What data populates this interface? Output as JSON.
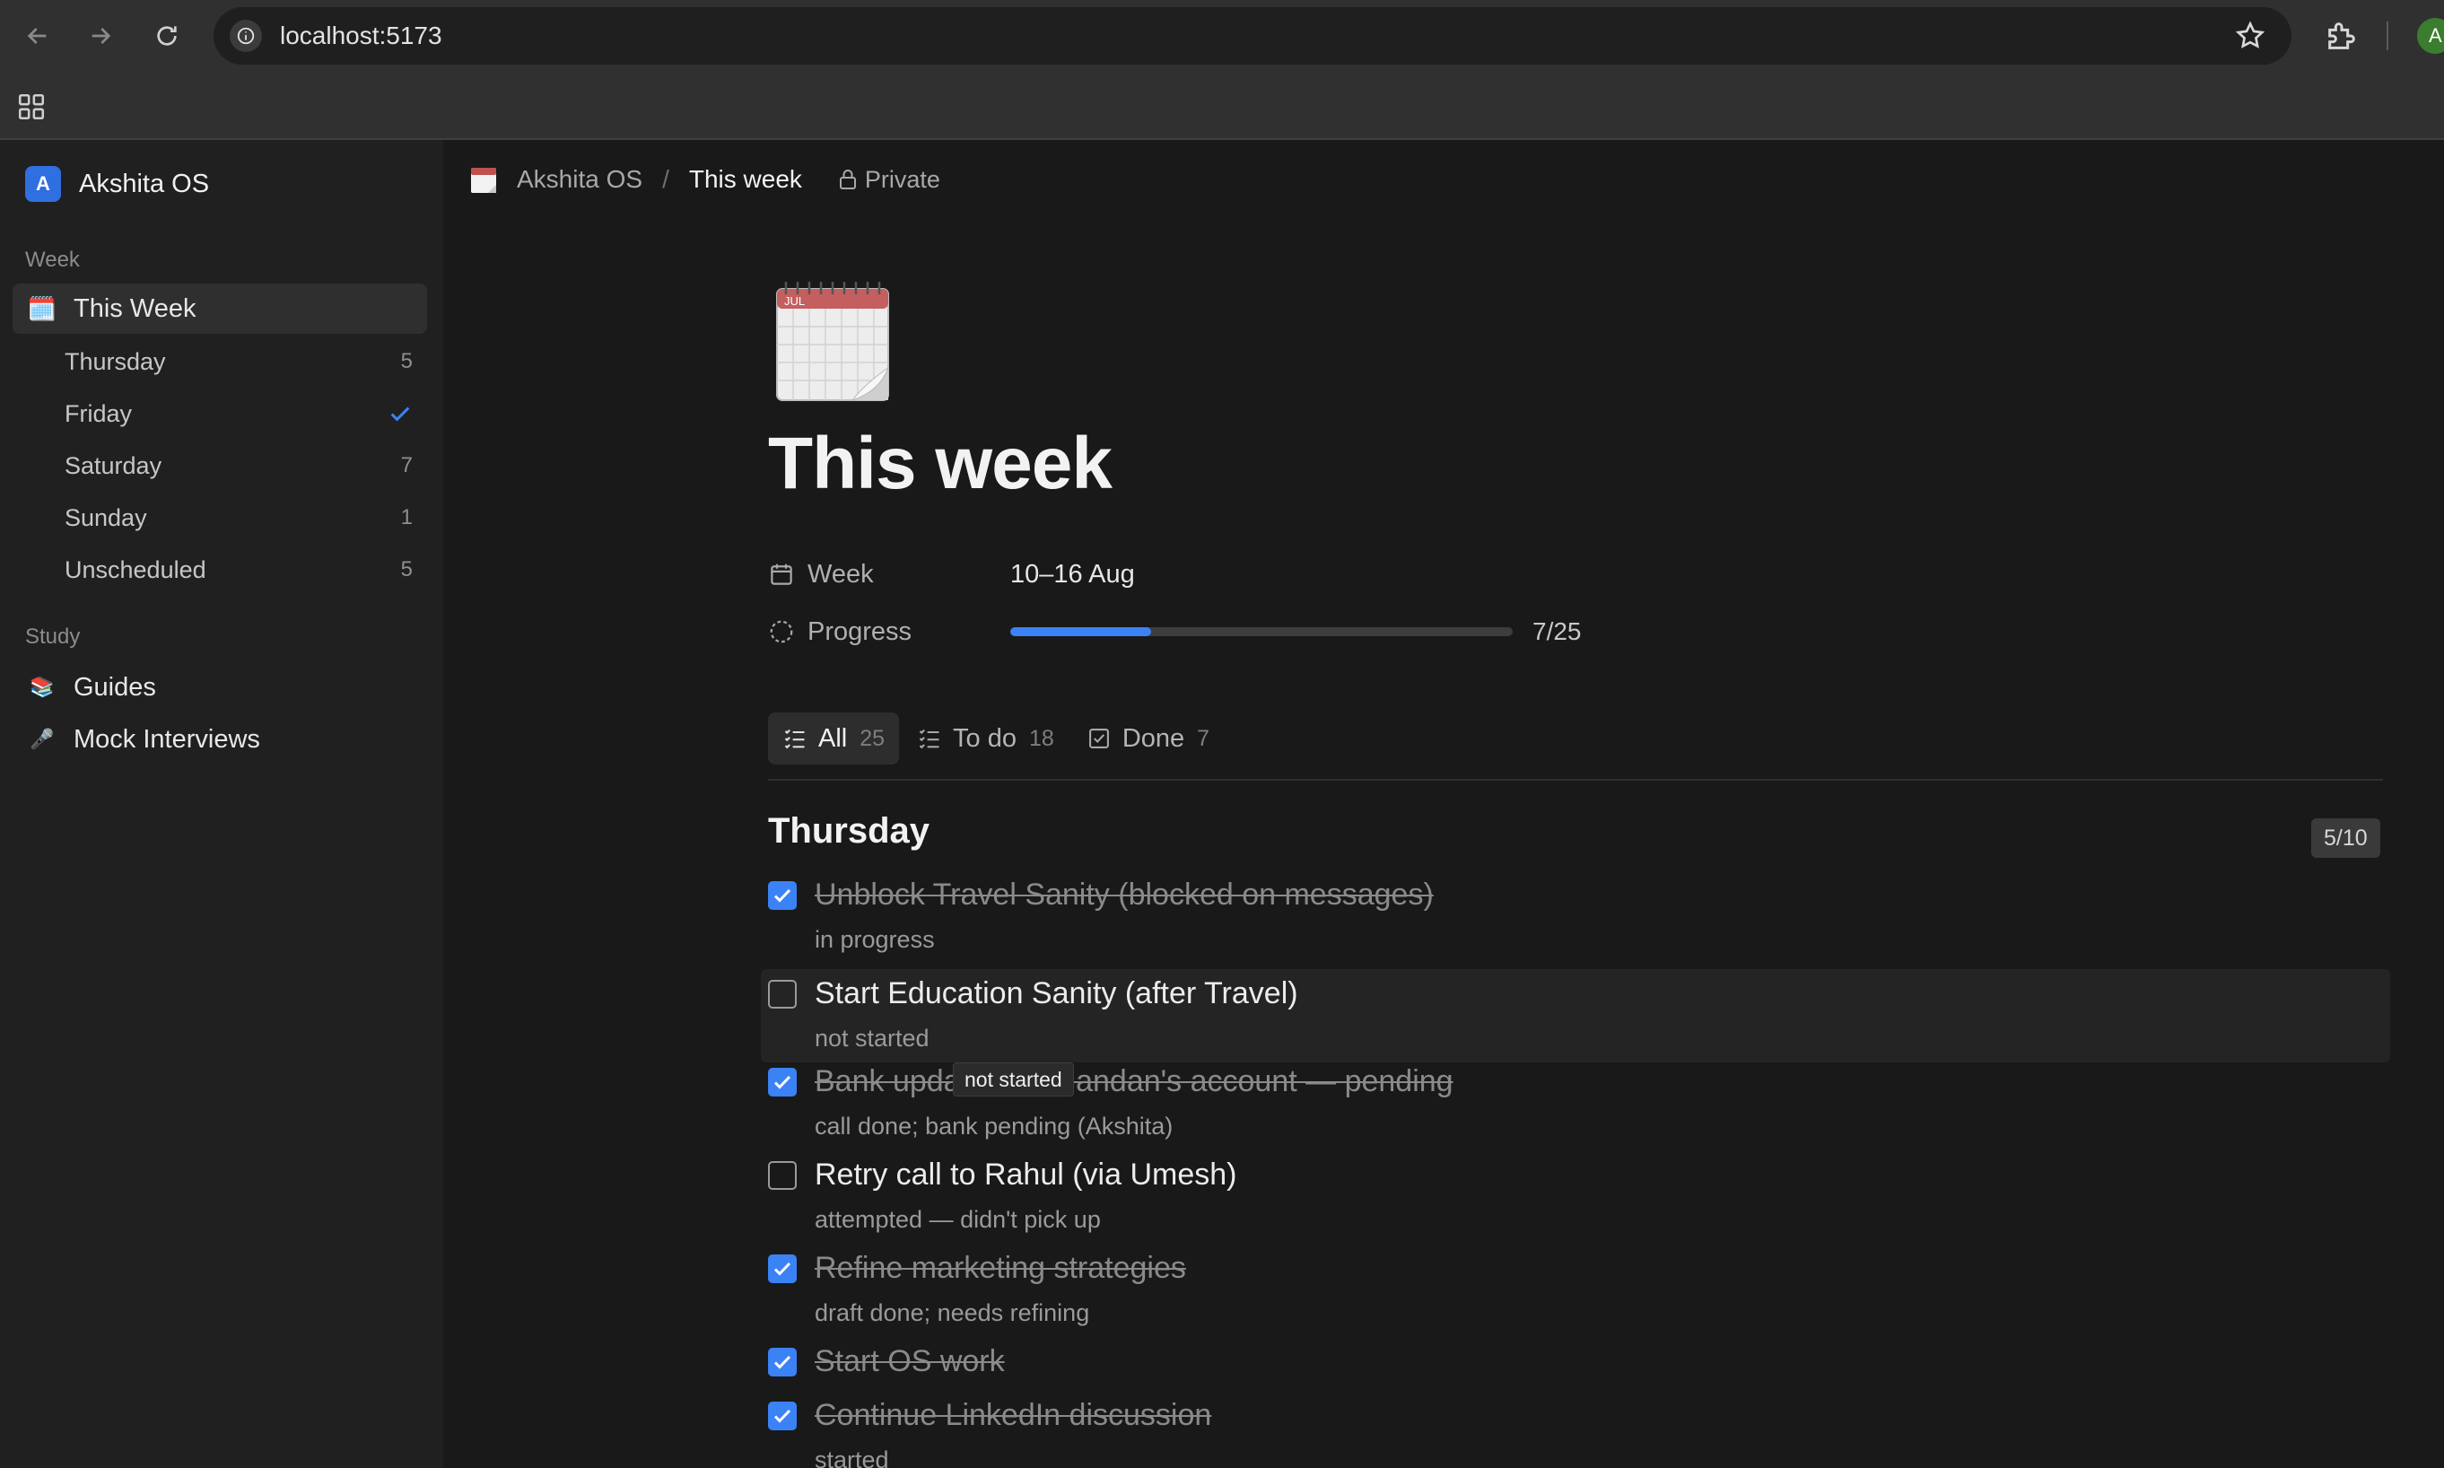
{
  "browser": {
    "url": "localhost:5173",
    "profile_initial": "A"
  },
  "sidebar": {
    "workspace_initial": "A",
    "workspace_name": "Akshita OS",
    "sections": {
      "week": "Week",
      "study": "Study"
    },
    "this_week": {
      "emoji": "🗓️",
      "label": "This Week"
    },
    "days": [
      {
        "label": "Thursday",
        "count": "5"
      },
      {
        "label": "Friday",
        "count": "",
        "status": "done"
      },
      {
        "label": "Saturday",
        "count": "7"
      },
      {
        "label": "Sunday",
        "count": "1"
      },
      {
        "label": "Unscheduled",
        "count": "5"
      }
    ],
    "study_items": [
      {
        "emoji": "📚",
        "label": "Guides"
      },
      {
        "emoji": "🎤",
        "label": "Mock Interviews"
      }
    ]
  },
  "breadcrumb": {
    "workspace": "Akshita OS",
    "separator": "/",
    "page": "This week",
    "visibility": "Private"
  },
  "page": {
    "title": "This week",
    "properties": {
      "week_label": "Week",
      "week_value": "10–16 Aug",
      "progress_label": "Progress",
      "progress_text": "7/25",
      "progress_fraction": 0.28
    },
    "tabs": [
      {
        "label": "All",
        "count": "25"
      },
      {
        "label": "To do",
        "count": "18"
      },
      {
        "label": "Done",
        "count": "7"
      }
    ],
    "group": {
      "title": "Thursday",
      "badge": "5/10",
      "tasks": [
        {
          "title": "Unblock Travel Sanity (blocked on messages)",
          "note": "in progress",
          "done": true
        },
        {
          "title": "Start Education Sanity (after Travel)",
          "note": "not started",
          "done": false
        },
        {
          "title": "Bank update on Chandan's account — pending",
          "note": "call done; bank pending (Akshita)",
          "done": true
        },
        {
          "title": "Retry call to Rahul (via Umesh)",
          "note": "attempted — didn't pick up",
          "done": false
        },
        {
          "title": "Refine marketing strategies",
          "note": "draft done; needs refining",
          "done": true
        },
        {
          "title": "Start OS work",
          "note": "",
          "done": true
        },
        {
          "title": "Continue LinkedIn discussion",
          "note": "started",
          "done": true
        }
      ]
    },
    "tooltip": "not started"
  },
  "colors": {
    "accent": "#3b82f6",
    "background": "#191919",
    "sidebar": "#202020"
  }
}
